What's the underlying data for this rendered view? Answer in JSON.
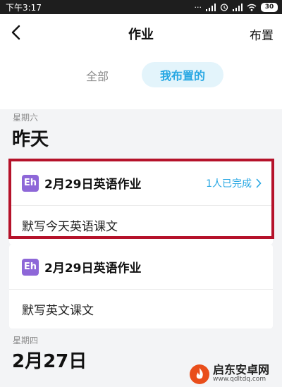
{
  "status_bar": {
    "time": "下午3:17",
    "battery": "30",
    "icons": [
      "dots-icon",
      "signal-icon",
      "alarm-icon",
      "signal-icon",
      "wifi-icon",
      "battery-icon"
    ]
  },
  "header": {
    "title": "作业",
    "assign_label": "布置",
    "back_icon": "chevron-left-icon"
  },
  "tabs": {
    "all": "全部",
    "mine": "我布置的",
    "active": "mine"
  },
  "groups": [
    {
      "weekday": "星期六",
      "day": "昨天",
      "items": [
        {
          "badge": "Eh",
          "title": "2月29日英语作业",
          "status": "1人已完成",
          "description": "默写今天英语课文"
        },
        {
          "badge": "Eh",
          "title": "2月29日英语作业",
          "status": "",
          "description": "默写英文课文"
        }
      ]
    },
    {
      "weekday": "星期四",
      "day": "2月27日",
      "items": []
    }
  ],
  "watermark": {
    "name": "启东安卓网",
    "url": "www.qdltdq.com"
  },
  "colors": {
    "accent": "#27a7e3",
    "accent_bg": "#e3f4fb",
    "badge": "#8e67d8",
    "highlight": "#b5122a"
  }
}
